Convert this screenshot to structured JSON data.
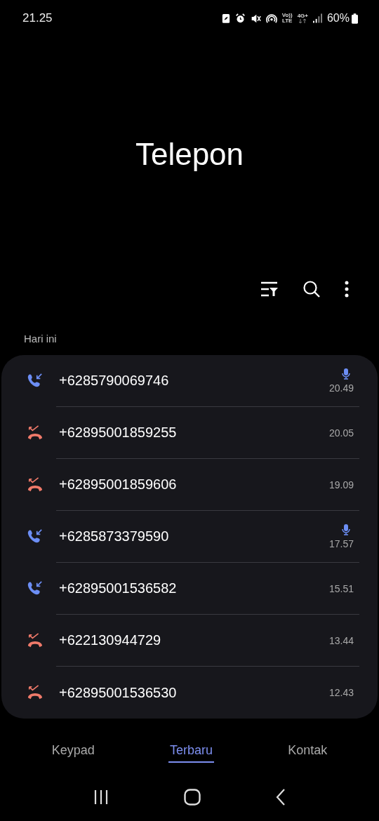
{
  "status_bar": {
    "time": "21.25",
    "network_voice": "Vo))",
    "network_lte": "LTE",
    "network_type": "4G+",
    "battery": "60%"
  },
  "title": "Telepon",
  "section_label": "Hari ini",
  "calls": [
    {
      "number": "+6285790069746",
      "time": "20.49",
      "kind": "incoming",
      "recorded": true
    },
    {
      "number": "+62895001859255",
      "time": "20.05",
      "kind": "missed",
      "recorded": false
    },
    {
      "number": "+62895001859606",
      "time": "19.09",
      "kind": "missed",
      "recorded": false
    },
    {
      "number": "+6285873379590",
      "time": "17.57",
      "kind": "incoming",
      "recorded": true
    },
    {
      "number": "+62895001536582",
      "time": "15.51",
      "kind": "incoming",
      "recorded": false
    },
    {
      "number": "+622130944729",
      "time": "13.44",
      "kind": "missed",
      "recorded": false
    },
    {
      "number": "+62895001536530",
      "time": "12.43",
      "kind": "missed",
      "recorded": false
    }
  ],
  "tabs": [
    {
      "label": "Keypad",
      "selected": false
    },
    {
      "label": "Terbaru",
      "selected": true
    },
    {
      "label": "Kontak",
      "selected": false
    }
  ]
}
